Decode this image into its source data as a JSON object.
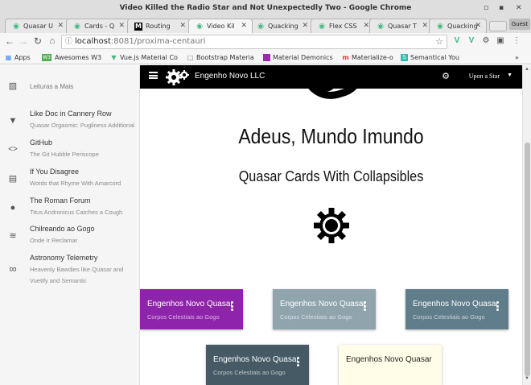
{
  "window": {
    "title": "Video Killed the Radio Star and Not Unexpectedly Two - Google Chrome",
    "controls": [
      "▫",
      "▪",
      "✕"
    ]
  },
  "tabs": [
    {
      "label": "Quasar U",
      "icon": "vue-icon"
    },
    {
      "label": "Cards - Q",
      "icon": "vue-icon"
    },
    {
      "label": "Routing",
      "icon": "medium-icon"
    },
    {
      "label": "Video Kil",
      "icon": "vue-icon",
      "active": true
    },
    {
      "label": "Quacking",
      "icon": "vue-icon"
    },
    {
      "label": "Flex CSS",
      "icon": "vue-icon"
    },
    {
      "label": "Quasar T",
      "icon": "vue-icon"
    },
    {
      "label": "Quacking",
      "icon": "vue-icon"
    }
  ],
  "profile": {
    "label": "Guest"
  },
  "address": {
    "host": "localhost",
    "path": ":8081/proxima-centauri"
  },
  "bookmarks": [
    {
      "label": "Apps",
      "icon": "apps-icon"
    },
    {
      "label": "Awesomes W3",
      "icon": "w3-icon"
    },
    {
      "label": "Vue.js Material Co",
      "icon": "vue-icon"
    },
    {
      "label": "Bootstrap Materia",
      "icon": "page-icon"
    },
    {
      "label": "Material Demonics",
      "icon": "material-icon"
    },
    {
      "label": "Materialize-o",
      "icon": "materialize-icon"
    },
    {
      "label": "Semantical You",
      "icon": "semantic-icon"
    }
  ],
  "drawer": {
    "header": "Leituras a Mais",
    "items": [
      {
        "title": "Like Doc in Cannery Row",
        "subtitle": "Quasar Orgasmic: Pugliness Additional",
        "icon": "school-icon"
      },
      {
        "title": "GitHub",
        "subtitle": "The Git Hubble Periscope",
        "icon": "code-icon"
      },
      {
        "title": "If You Disagree",
        "subtitle": "Words that Rhyme With Amarcord",
        "icon": "chat-icon"
      },
      {
        "title": "The Roman Forum",
        "subtitle": "Titus Andronicus Catches a Cough",
        "icon": "record-voice-icon"
      },
      {
        "title": "Chilreando ao Gogo",
        "subtitle": "Onde Ir Reclamar",
        "icon": "rss-icon"
      },
      {
        "title": "Astronomy Telemetry",
        "subtitle": "Heavenly Bawdies like Quasar and",
        "subtitle2": "Vuetify and Semantic",
        "icon": "infinity-icon"
      }
    ]
  },
  "header": {
    "title": "Engenho Novo LLC",
    "menu": "Upon a Star"
  },
  "content": {
    "heading": "Adeus, Mundo Imundo",
    "subheading": "Quasar Cards With Collapsibles"
  },
  "cards": [
    {
      "title": "Engenhos Novo Quasar",
      "subtitle": "Corpos Celestiais ao Gogo",
      "color": "#8e24aa"
    },
    {
      "title": "Engenhos Novo Quasar",
      "subtitle": "Corpos Celestiais ao Gogo",
      "color": "#90a4ae"
    },
    {
      "title": "Engenhos Novo Quasar",
      "subtitle": "Corpos Celestiais ao Gogo",
      "color": "#607d8b"
    },
    {
      "title": "Engenhos Novo Quasar",
      "subtitle": "Corpos Celestiais ao Gogo",
      "color": "#455a64"
    },
    {
      "title": "Engenhos Novo Quasar",
      "subtitle": "",
      "color": "#fffde7"
    }
  ]
}
